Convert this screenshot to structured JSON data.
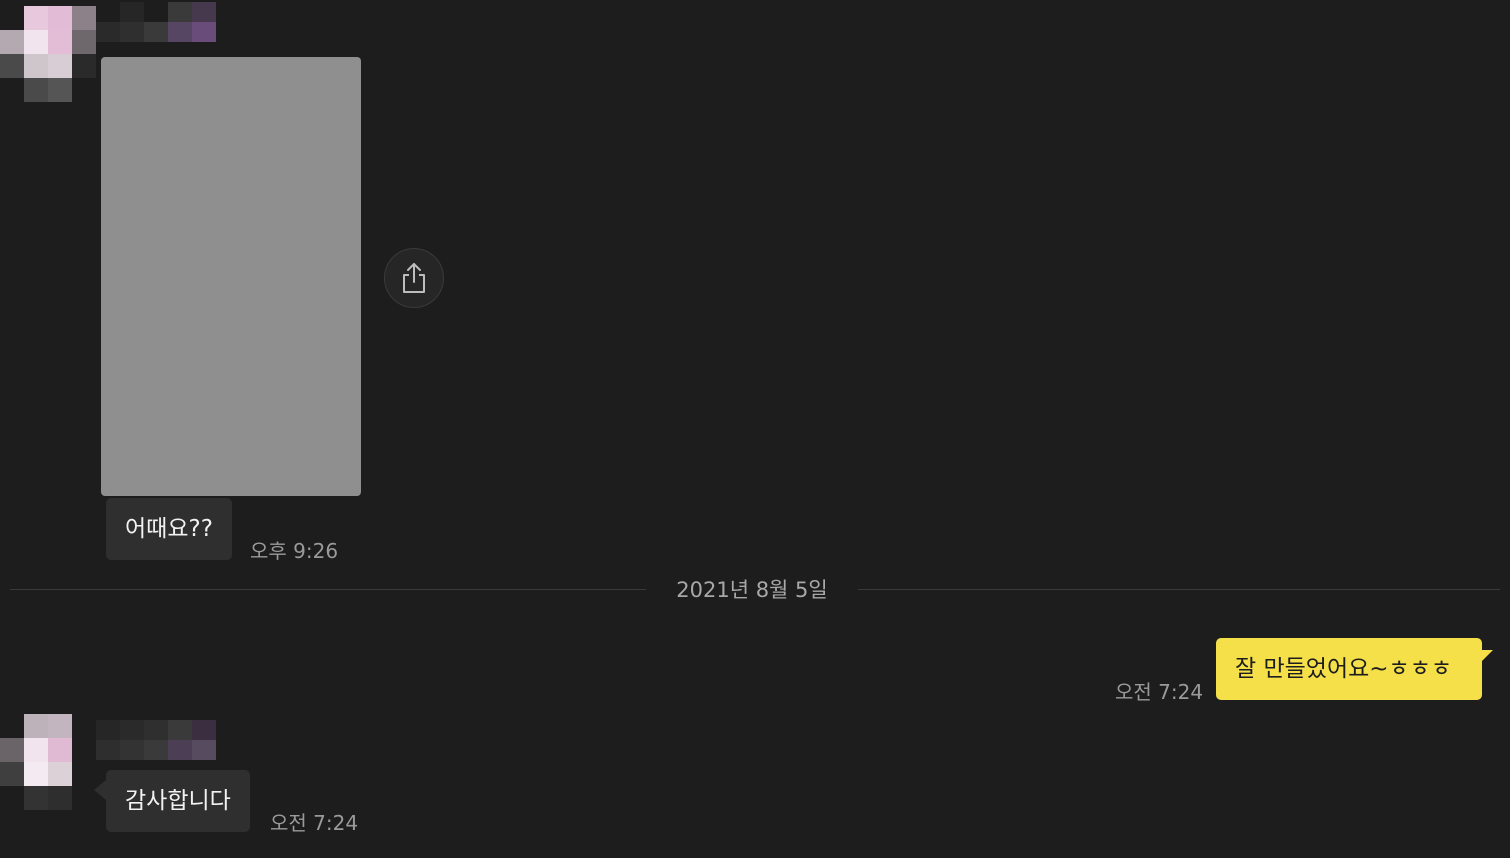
{
  "messages": {
    "first": {
      "text": "어때요??",
      "time": "오후 9:26"
    },
    "date_divider": "2021년 8월 5일",
    "mine": {
      "text": "잘 만들었어요~ㅎㅎㅎ",
      "time": "오전 7:24"
    },
    "second": {
      "text": "감사합니다",
      "time": "오전 7:24"
    }
  },
  "icons": {
    "share": "share-icon"
  },
  "colors": {
    "background": "#1d1d1d",
    "incoming_bubble": "#2f2f2f",
    "outgoing_bubble": "#f5e04a",
    "timestamp": "#9a9a9a",
    "photo_placeholder": "#8f8f8f"
  }
}
